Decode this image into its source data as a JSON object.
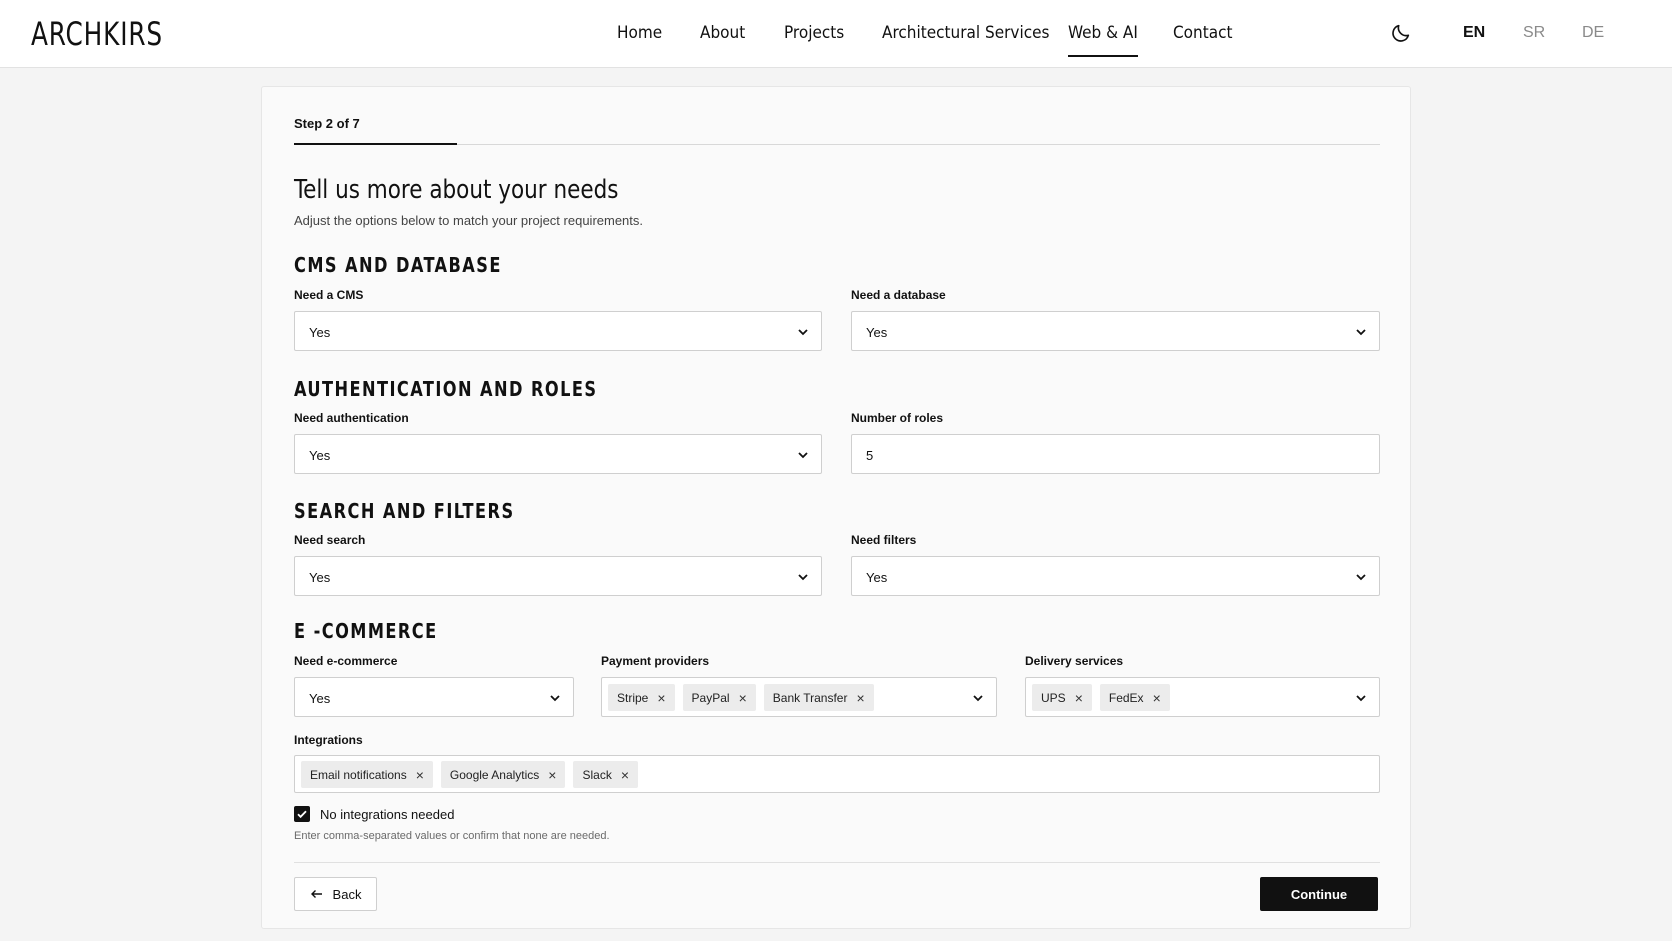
{
  "brand": {
    "logo": "ARCHKIRS"
  },
  "nav": {
    "items": [
      {
        "label": "Home"
      },
      {
        "label": "About"
      },
      {
        "label": "Projects"
      },
      {
        "label": "Architectural Services"
      },
      {
        "label": "Web & AI",
        "active": true
      },
      {
        "label": "Contact"
      }
    ],
    "theme_icon": "moon-icon",
    "languages": [
      {
        "label": "EN",
        "active": true
      },
      {
        "label": "SR"
      },
      {
        "label": "DE"
      }
    ]
  },
  "form": {
    "step": "Step 2 of 7",
    "progress": 0.142,
    "title": "Tell us more about your needs",
    "subtitle": "Adjust the options below to match your project requirements.",
    "sections": {
      "cms": {
        "heading": "CMS AND DATABASE",
        "need_cms_label": "Need a CMS",
        "need_cms_value": "Yes",
        "need_db_label": "Need a database",
        "need_db_value": "Yes"
      },
      "auth": {
        "heading": "AUTHENTICATION AND ROLES",
        "need_auth_label": "Need authentication",
        "need_auth_value": "Yes",
        "roles_label": "Number of roles",
        "roles_value": "5"
      },
      "search": {
        "heading": "SEARCH AND FILTERS",
        "need_search_label": "Need search",
        "need_search_value": "Yes",
        "need_filters_label": "Need filters",
        "need_filters_value": "Yes"
      },
      "ecommerce": {
        "heading": "E -COMMERCE",
        "need_ecom_label": "Need e-commerce",
        "need_ecom_value": "Yes",
        "payment_label": "Payment providers",
        "payment_values": [
          "Stripe",
          "PayPal",
          "Bank Transfer"
        ],
        "delivery_label": "Delivery services",
        "delivery_values": [
          "UPS",
          "FedEx"
        ]
      },
      "integrations": {
        "label": "Integrations",
        "values": [
          "Email notifications",
          "Google Analytics",
          "Slack"
        ],
        "no_integrations_label": "No integrations needed",
        "no_integrations_checked": true,
        "hint": "Enter comma-separated values or confirm that none are needed."
      }
    },
    "buttons": {
      "back": "Back",
      "continue": "Continue"
    },
    "chip_remove_glyph": "×"
  }
}
